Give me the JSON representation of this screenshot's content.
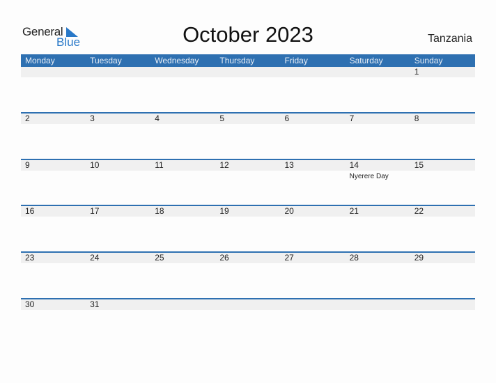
{
  "logo": {
    "line1": "General",
    "line2": "Blue",
    "brand_color": "#2878c8"
  },
  "title": "October 2023",
  "country": "Tanzania",
  "weekdays": [
    "Monday",
    "Tuesday",
    "Wednesday",
    "Thursday",
    "Friday",
    "Saturday",
    "Sunday"
  ],
  "header_color": "#2e70b1",
  "weeks": [
    {
      "days": [
        "",
        "",
        "",
        "",
        "",
        "",
        "1"
      ],
      "notes": [
        "",
        "",
        "",
        "",
        "",
        "",
        ""
      ]
    },
    {
      "days": [
        "2",
        "3",
        "4",
        "5",
        "6",
        "7",
        "8"
      ],
      "notes": [
        "",
        "",
        "",
        "",
        "",
        "",
        ""
      ]
    },
    {
      "days": [
        "9",
        "10",
        "11",
        "12",
        "13",
        "14",
        "15"
      ],
      "notes": [
        "",
        "",
        "",
        "",
        "",
        "Nyerere Day",
        ""
      ]
    },
    {
      "days": [
        "16",
        "17",
        "18",
        "19",
        "20",
        "21",
        "22"
      ],
      "notes": [
        "",
        "",
        "",
        "",
        "",
        "",
        ""
      ]
    },
    {
      "days": [
        "23",
        "24",
        "25",
        "26",
        "27",
        "28",
        "29"
      ],
      "notes": [
        "",
        "",
        "",
        "",
        "",
        "",
        ""
      ]
    },
    {
      "days": [
        "30",
        "31",
        "",
        "",
        "",
        "",
        ""
      ],
      "notes": [
        "",
        "",
        "",
        "",
        "",
        "",
        ""
      ]
    }
  ]
}
